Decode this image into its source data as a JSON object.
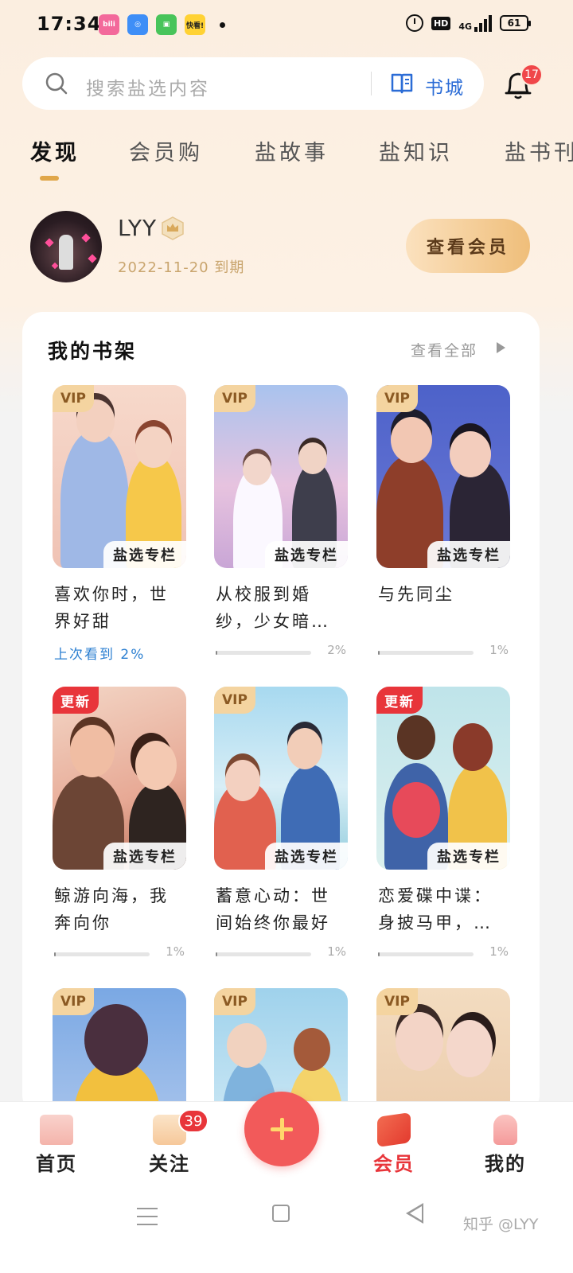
{
  "status_bar": {
    "time": "17:34",
    "app_icons": [
      {
        "name": "bilibili-icon",
        "label": "bili",
        "color": "#f3699b"
      },
      {
        "name": "browser-icon",
        "label": "◎",
        "color": "#3e8ef7"
      },
      {
        "name": "shopping-icon",
        "label": "▣",
        "color": "#48c45a"
      },
      {
        "name": "kuaikan-icon",
        "label": "快看!",
        "color": "#ffd234"
      }
    ],
    "hd": "HD",
    "network": "4G",
    "battery": "61"
  },
  "search": {
    "placeholder": "搜索盐选内容",
    "bookstore_label": "书城"
  },
  "notifications": {
    "count": "17"
  },
  "tabs": [
    {
      "label": "发现",
      "active": true
    },
    {
      "label": "会员购",
      "active": false
    },
    {
      "label": "盐故事",
      "active": false
    },
    {
      "label": "盐知识",
      "active": false
    },
    {
      "label": "盐书刊",
      "active": false
    }
  ],
  "member": {
    "username": "LYY",
    "expire_date": "2022-11-20",
    "expire_suffix": "到期",
    "view_member_button": "查看会员"
  },
  "shelf": {
    "title": "我的书架",
    "view_all": "查看全部",
    "column_label": "盐选专栏",
    "books": [
      {
        "title": "喜欢你时，世界好甜",
        "tag": "VIP",
        "progress_text": "上次看到 2%",
        "progress": 0.02,
        "pct": ""
      },
      {
        "title": "从校服到婚纱，少女暗…",
        "tag": "VIP",
        "progress_text": "",
        "progress": 0.02,
        "pct": "2%"
      },
      {
        "title": "与先同尘",
        "tag": "VIP",
        "progress_text": "",
        "progress": 0.01,
        "pct": "1%"
      },
      {
        "title": "鲸游向海，我奔向你",
        "tag": "更新",
        "progress_text": "",
        "progress": 0.01,
        "pct": "1%"
      },
      {
        "title": "蓄意心动：世间始终你最好",
        "tag": "VIP",
        "progress_text": "",
        "progress": 0.01,
        "pct": "1%"
      },
      {
        "title": "恋爱碟中谍：身披马甲，…",
        "tag": "更新",
        "progress_text": "",
        "progress": 0.01,
        "pct": "1%"
      },
      {
        "title": "",
        "tag": "VIP",
        "progress_text": "",
        "progress": 0,
        "pct": ""
      },
      {
        "title": "",
        "tag": "VIP",
        "progress_text": "",
        "progress": 0,
        "pct": ""
      },
      {
        "title": "",
        "tag": "VIP",
        "progress_text": "",
        "progress": 0,
        "pct": ""
      }
    ]
  },
  "bottom_nav": {
    "items": [
      {
        "label": "首页",
        "icon": "castle-icon"
      },
      {
        "label": "关注",
        "icon": "follow-icon"
      },
      {
        "label": "会员",
        "icon": "flag-icon"
      },
      {
        "label": "我的",
        "icon": "profile-icon"
      }
    ],
    "follow_badge": "39",
    "active": "会员"
  },
  "watermark": "知乎 @LYY",
  "colors": {
    "accent_gold": "#efbe7a",
    "brand_red": "#e8353a",
    "link_blue": "#2b6cd6"
  }
}
